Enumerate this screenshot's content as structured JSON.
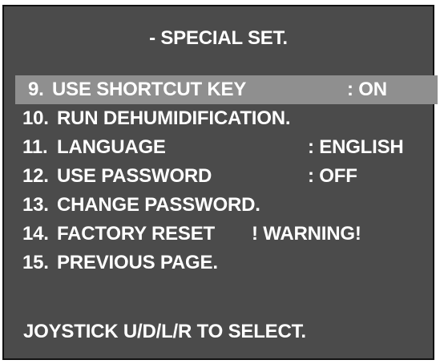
{
  "menu": {
    "title": "- SPECIAL SET.",
    "items": [
      {
        "number": "9.",
        "label": "USE SHORTCUT KEY",
        "value": ": ON",
        "selected": true
      },
      {
        "number": "10.",
        "label": "RUN DEHUMIDIFICATION.",
        "value": "",
        "selected": false
      },
      {
        "number": "11.",
        "label": "LANGUAGE",
        "value": ": ENGLISH",
        "selected": false
      },
      {
        "number": "12.",
        "label": "USE PASSWORD",
        "value": ": OFF",
        "selected": false
      },
      {
        "number": "13.",
        "label": "CHANGE PASSWORD.",
        "value": "",
        "selected": false
      },
      {
        "number": "14.",
        "label": "FACTORY RESET",
        "value": "! WARNING!",
        "selected": false
      },
      {
        "number": "15.",
        "label": "PREVIOUS PAGE.",
        "value": "",
        "selected": false
      }
    ],
    "footer": "JOYSTICK U/D/L/R TO SELECT."
  },
  "colors": {
    "background": "#4b4b4b",
    "highlight": "#8f8f8f",
    "text": "#ffffff"
  }
}
